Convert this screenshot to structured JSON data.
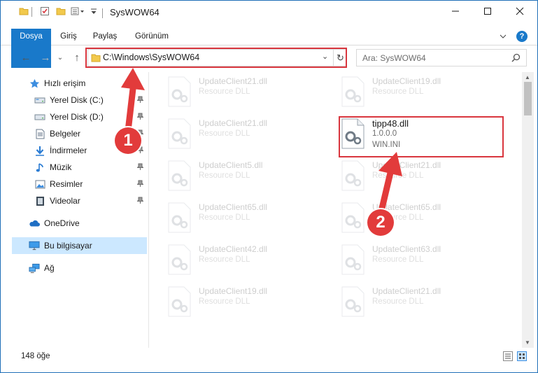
{
  "window": {
    "title": "SysWOW64",
    "min_glyph": "—",
    "max_glyph": "☐",
    "close_glyph": "✕"
  },
  "ribbon": {
    "tabs": [
      "Dosya",
      "Giriş",
      "Paylaş",
      "Görünüm"
    ]
  },
  "address": {
    "path": "C:\\Windows\\SysWOW64",
    "dropdown_glyph": "⌄",
    "refresh_glyph": "↻"
  },
  "nav": {
    "back_glyph": "←",
    "forward_glyph": "→",
    "recent_glyph": "⌄",
    "up_glyph": "↑"
  },
  "search": {
    "placeholder": "Ara: SysWOW64"
  },
  "sidebar": {
    "quick_access": "Hızlı erişim",
    "items": [
      {
        "label": "Yerel Disk (C:)",
        "icon": "drive-icon"
      },
      {
        "label": "Yerel Disk (D:)",
        "icon": "drive-icon"
      },
      {
        "label": "Belgeler",
        "icon": "documents-icon"
      },
      {
        "label": "İndirmeler",
        "icon": "downloads-icon"
      },
      {
        "label": "Müzik",
        "icon": "music-icon"
      },
      {
        "label": "Resimler",
        "icon": "pictures-icon"
      },
      {
        "label": "Videolar",
        "icon": "videos-icon"
      }
    ],
    "onedrive": "OneDrive",
    "this_pc": "Bu bilgisayar",
    "network": "Ağ"
  },
  "files": {
    "left_column": [
      {
        "name": "UpdateClient21.dll",
        "desc": "Resource DLL"
      },
      {
        "name": "UpdateClient21.dll",
        "desc": "Resource DLL"
      },
      {
        "name": "UpdateClient5.dll",
        "desc": "Resource DLL"
      },
      {
        "name": "UpdateClient65.dll",
        "desc": "Resource DLL"
      },
      {
        "name": "UpdateClient42.dll",
        "desc": "Resource DLL"
      },
      {
        "name": "UpdateClient19.dll",
        "desc": "Resource DLL"
      }
    ],
    "right_column": [
      {
        "name": "UpdateClient19.dll",
        "desc": "Resource DLL"
      },
      {
        "name": "UpdateClient21.dll",
        "desc": "Resource DLL"
      },
      {
        "name": "UpdateClient65.dll",
        "desc": "Resource DLL"
      },
      {
        "name": "UpdateClient63.dll",
        "desc": "Resource DLL"
      },
      {
        "name": "UpdateClient21.dll",
        "desc": "Resource DLL"
      }
    ],
    "highlighted": {
      "name": "tipp48.dll",
      "version": "1.0.0.0",
      "desc": "WIN.INI"
    }
  },
  "status": {
    "item_count": "148 öğe"
  },
  "annotations": {
    "step1": "1",
    "step2": "2"
  },
  "colors": {
    "accent": "#1979ca",
    "highlight_red": "#d9363e",
    "selection": "#cce8ff"
  }
}
